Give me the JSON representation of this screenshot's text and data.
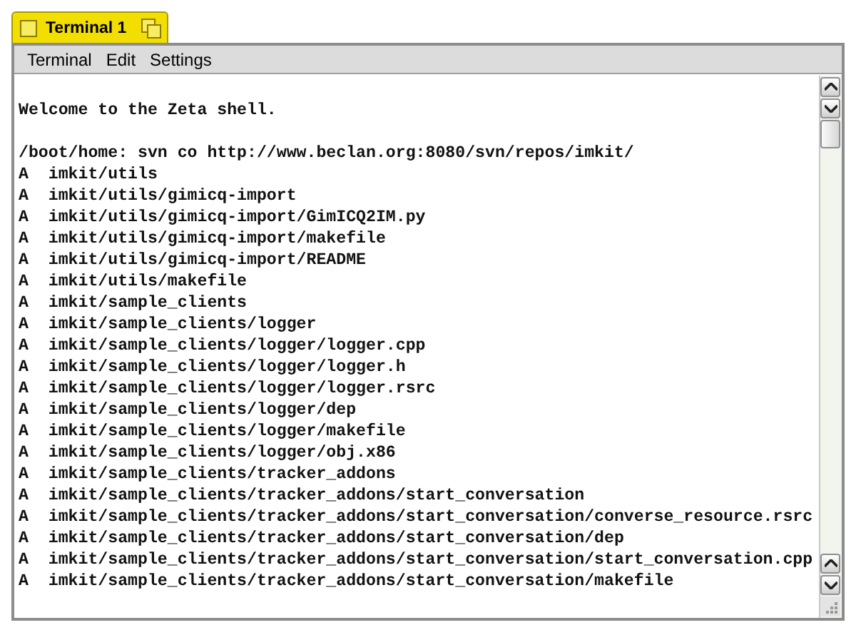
{
  "window": {
    "tab": {
      "title": "Terminal 1",
      "selected": true
    }
  },
  "menu_bar": {
    "items": [
      "Terminal",
      "Edit",
      "Settings"
    ]
  },
  "terminal": {
    "lines": [
      {
        "kind": "blank"
      },
      {
        "kind": "text",
        "text": "Welcome to the Zeta shell."
      },
      {
        "kind": "blank"
      },
      {
        "kind": "text",
        "text": "/boot/home: svn co http://www.beclan.org:8080/svn/repos/imkit/"
      },
      {
        "kind": "text",
        "text": "A  imkit/utils"
      },
      {
        "kind": "text",
        "text": "A  imkit/utils/gimicq-import"
      },
      {
        "kind": "text",
        "text": "A  imkit/utils/gimicq-import/GimICQ2IM.py"
      },
      {
        "kind": "text",
        "text": "A  imkit/utils/gimicq-import/makefile"
      },
      {
        "kind": "text",
        "text": "A  imkit/utils/gimicq-import/README"
      },
      {
        "kind": "text",
        "text": "A  imkit/utils/makefile"
      },
      {
        "kind": "text",
        "text": "A  imkit/sample_clients"
      },
      {
        "kind": "text",
        "text": "A  imkit/sample_clients/logger"
      },
      {
        "kind": "text",
        "text": "A  imkit/sample_clients/logger/logger.cpp"
      },
      {
        "kind": "text",
        "text": "A  imkit/sample_clients/logger/logger.h"
      },
      {
        "kind": "text",
        "text": "A  imkit/sample_clients/logger/logger.rsrc"
      },
      {
        "kind": "text",
        "text": "A  imkit/sample_clients/logger/dep"
      },
      {
        "kind": "text",
        "text": "A  imkit/sample_clients/logger/makefile"
      },
      {
        "kind": "text",
        "text": "A  imkit/sample_clients/logger/obj.x86"
      },
      {
        "kind": "text",
        "text": "A  imkit/sample_clients/tracker_addons"
      },
      {
        "kind": "text",
        "text": "A  imkit/sample_clients/tracker_addons/start_conversation"
      },
      {
        "kind": "text",
        "text": "A  imkit/sample_clients/tracker_addons/start_conversation/converse_resource.rsrc"
      },
      {
        "kind": "text",
        "text": "A  imkit/sample_clients/tracker_addons/start_conversation/dep"
      },
      {
        "kind": "text",
        "text": "A  imkit/sample_clients/tracker_addons/start_conversation/start_conversation.cpp"
      },
      {
        "kind": "text",
        "text": "A  imkit/sample_clients/tracker_addons/start_conversation/makefile"
      }
    ]
  }
}
